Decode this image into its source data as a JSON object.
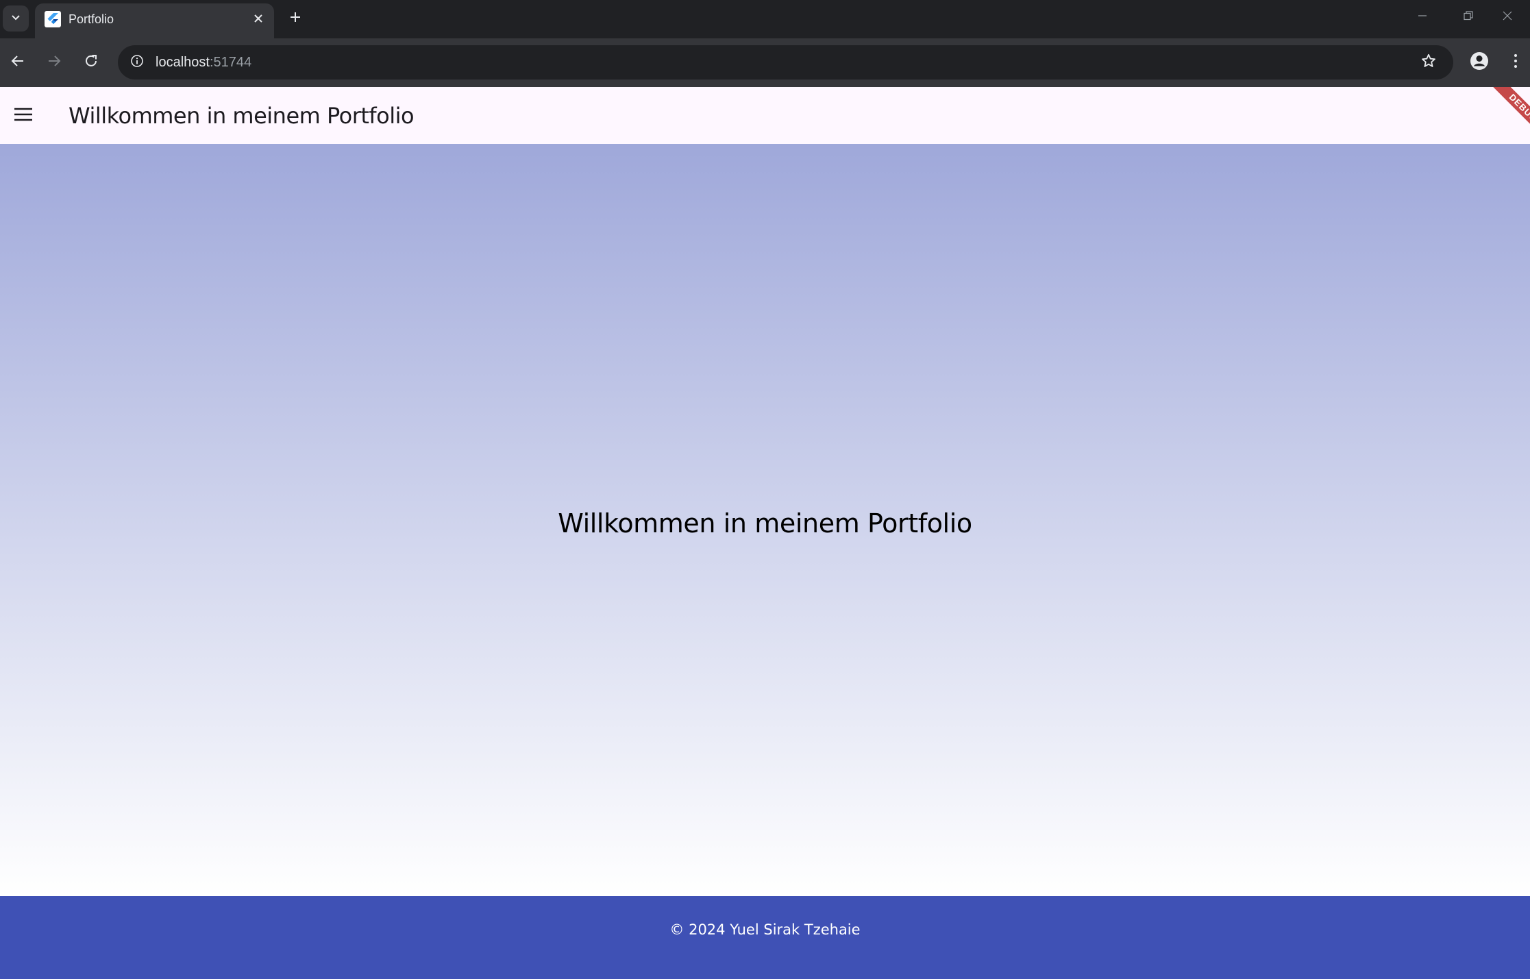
{
  "browser": {
    "tab": {
      "title": "Portfolio",
      "favicon": "flutter-icon"
    },
    "address_bar": {
      "host": "localhost",
      "port": ":51744"
    },
    "icons": {
      "tab_list": "chevron-down-icon",
      "close_tab": "close-icon",
      "new_tab": "plus-icon",
      "minimize": "minimize-icon",
      "restore": "restore-icon",
      "close_window": "close-icon",
      "back": "arrow-left-icon",
      "forward": "arrow-right-icon",
      "reload": "reload-icon",
      "site_info": "info-icon",
      "bookmark": "star-icon",
      "profile": "account-icon",
      "menu": "more-vert-icon"
    },
    "colors": {
      "tabstrip": "#202124",
      "toolbar": "#35363a",
      "omnibox": "#202124"
    }
  },
  "app": {
    "appbar": {
      "title": "Willkommen in meinem Portfolio",
      "menu_icon": "hamburger-menu-icon",
      "background": "#fef7ff"
    },
    "debug_banner": "DEBUG",
    "hero": {
      "title": "Willkommen in meinem Portfolio",
      "gradient_top": "#9fa8da",
      "gradient_bottom": "#ffffff"
    },
    "footer": {
      "text": "© 2024 Yuel Sirak Tzehaie",
      "background": "#3f51b5"
    }
  }
}
